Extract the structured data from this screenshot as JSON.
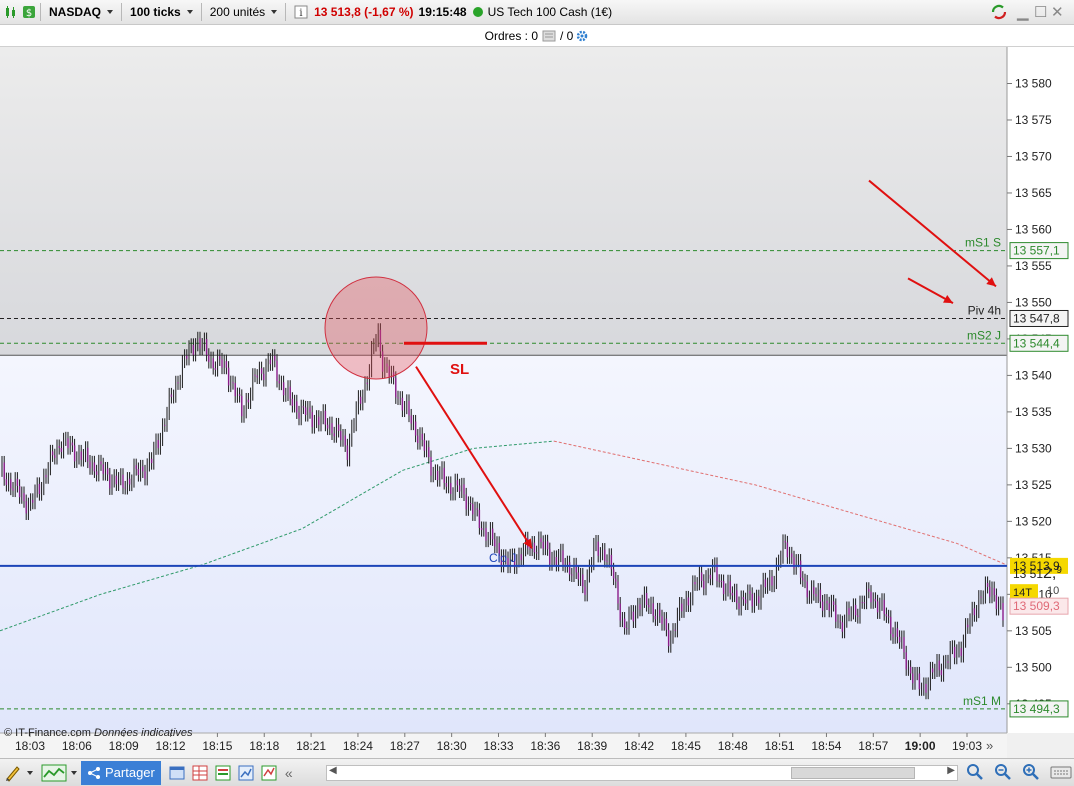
{
  "topbar": {
    "instrument": "NASDAQ",
    "ticks": "100 ticks",
    "units": "200 unités",
    "price": "13 513,8 (-1,67 %)",
    "time": "19:15:48",
    "name": "US Tech 100 Cash (1€)"
  },
  "orders": {
    "label": "Ordres : 0",
    "sep": "/ 0"
  },
  "footer": {
    "source": "© IT-Finance.com",
    "note": "Données indicatives"
  },
  "bottombar": {
    "share_label": "Partager"
  },
  "colors": {
    "close_line": "#1c44b8",
    "pivot_green": "#2d8a2d",
    "ma_green": "#2f9a6a",
    "ma_red": "#e07070",
    "annotation_red": "#e01010"
  },
  "chart_data": {
    "type": "line",
    "ylim": [
      13491,
      13585
    ],
    "y_ticks": [
      "13 580",
      "13 575",
      "13 570",
      "13 565",
      "13 560",
      "13 555",
      "13 550",
      "13 545",
      "13 540",
      "13 535",
      "13 530",
      "13 525",
      "13 520",
      "13 515",
      "13 510",
      "13 505",
      "13 500",
      "13 495"
    ],
    "y_tick_values": [
      13580,
      13575,
      13570,
      13565,
      13560,
      13555,
      13550,
      13545,
      13540,
      13535,
      13530,
      13525,
      13520,
      13515,
      13510,
      13505,
      13500,
      13495
    ],
    "x_ticks": [
      "18:03",
      "18:06",
      "18:09",
      "18:12",
      "18:15",
      "18:18",
      "18:21",
      "18:24",
      "18:27",
      "18:30",
      "18:33",
      "18:36",
      "18:39",
      "18:42",
      "18:45",
      "18:48",
      "18:51",
      "18:54",
      "18:57",
      "19:00",
      "19:03"
    ],
    "bold_x_tick": "19:00",
    "levels": [
      {
        "name": "mS1 S",
        "value": 13557.1,
        "tag": "13 557,1"
      },
      {
        "name": "Piv 4h",
        "value": 13547.8,
        "tag": "13 547,8"
      },
      {
        "name": "mS2 J",
        "value": 13544.4,
        "tag": "13 544,4"
      },
      {
        "name": "mS1 M",
        "value": 13494.3,
        "tag": "13 494,3"
      }
    ],
    "close_line": {
      "name": "Clo J",
      "value": 13513.9,
      "tag": "13 513,9"
    },
    "last_price": {
      "prefix": "13 51",
      "big": "2,",
      "small": "9",
      "value": 13512.9
    },
    "ticks_counter": "14T",
    "ticks_counter_value": "10",
    "red_tag": "13 509,3",
    "annotation": "SL",
    "price_path": [
      [
        0,
        13527
      ],
      [
        3,
        13522
      ],
      [
        6,
        13531
      ],
      [
        9,
        13528
      ],
      [
        12,
        13525
      ],
      [
        15,
        13528
      ],
      [
        18,
        13541
      ],
      [
        19.5,
        13545
      ],
      [
        21,
        13542
      ],
      [
        22.5,
        13541
      ],
      [
        24,
        13535
      ],
      [
        25.5,
        13540
      ],
      [
        27,
        13542
      ],
      [
        28.5,
        13537
      ],
      [
        30,
        13535
      ],
      [
        31.5,
        13534
      ],
      [
        33,
        13533
      ],
      [
        34.5,
        13530
      ],
      [
        35,
        13533
      ],
      [
        36.5,
        13540
      ],
      [
        37.5,
        13546
      ],
      [
        38,
        13542
      ],
      [
        39,
        13539
      ],
      [
        40,
        13536
      ],
      [
        41.5,
        13532
      ],
      [
        43,
        13527
      ],
      [
        44.5,
        13525
      ],
      [
        46,
        13524
      ],
      [
        47.5,
        13520
      ],
      [
        49,
        13517
      ],
      [
        50.5,
        13514
      ],
      [
        52,
        13516
      ],
      [
        53.5,
        13517
      ],
      [
        55,
        13515
      ],
      [
        56.5,
        13514
      ],
      [
        58,
        13511
      ],
      [
        59,
        13516
      ],
      [
        60,
        13516
      ],
      [
        61,
        13512
      ],
      [
        62,
        13505
      ],
      [
        63.5,
        13509
      ],
      [
        65,
        13508
      ],
      [
        66.5,
        13504
      ],
      [
        68,
        13509
      ],
      [
        69.5,
        13512
      ],
      [
        71,
        13513
      ],
      [
        72.5,
        13510
      ],
      [
        74,
        13509
      ],
      [
        75.5,
        13510
      ],
      [
        77,
        13513
      ],
      [
        78,
        13517
      ],
      [
        79,
        13514
      ],
      [
        80.5,
        13510
      ],
      [
        82,
        13509
      ],
      [
        83.5,
        13506
      ],
      [
        85,
        13508
      ],
      [
        86.5,
        13510
      ],
      [
        88,
        13507
      ],
      [
        89.5,
        13503
      ],
      [
        90.5,
        13499
      ],
      [
        91.5,
        13497
      ],
      [
        92.5,
        13499
      ],
      [
        94,
        13501
      ],
      [
        95.5,
        13503
      ],
      [
        97,
        13509
      ],
      [
        98.5,
        13511
      ],
      [
        100,
        13505
      ]
    ],
    "ma_green_path": [
      [
        0,
        13505
      ],
      [
        10,
        13510
      ],
      [
        20,
        13514
      ],
      [
        30,
        13519
      ],
      [
        40,
        13527
      ],
      [
        47,
        13530
      ],
      [
        55,
        13531
      ]
    ],
    "ma_red_path": [
      [
        55,
        13531
      ],
      [
        65,
        13528
      ],
      [
        75,
        13525
      ],
      [
        85,
        13521
      ],
      [
        95,
        13517
      ],
      [
        100,
        13514
      ]
    ]
  }
}
